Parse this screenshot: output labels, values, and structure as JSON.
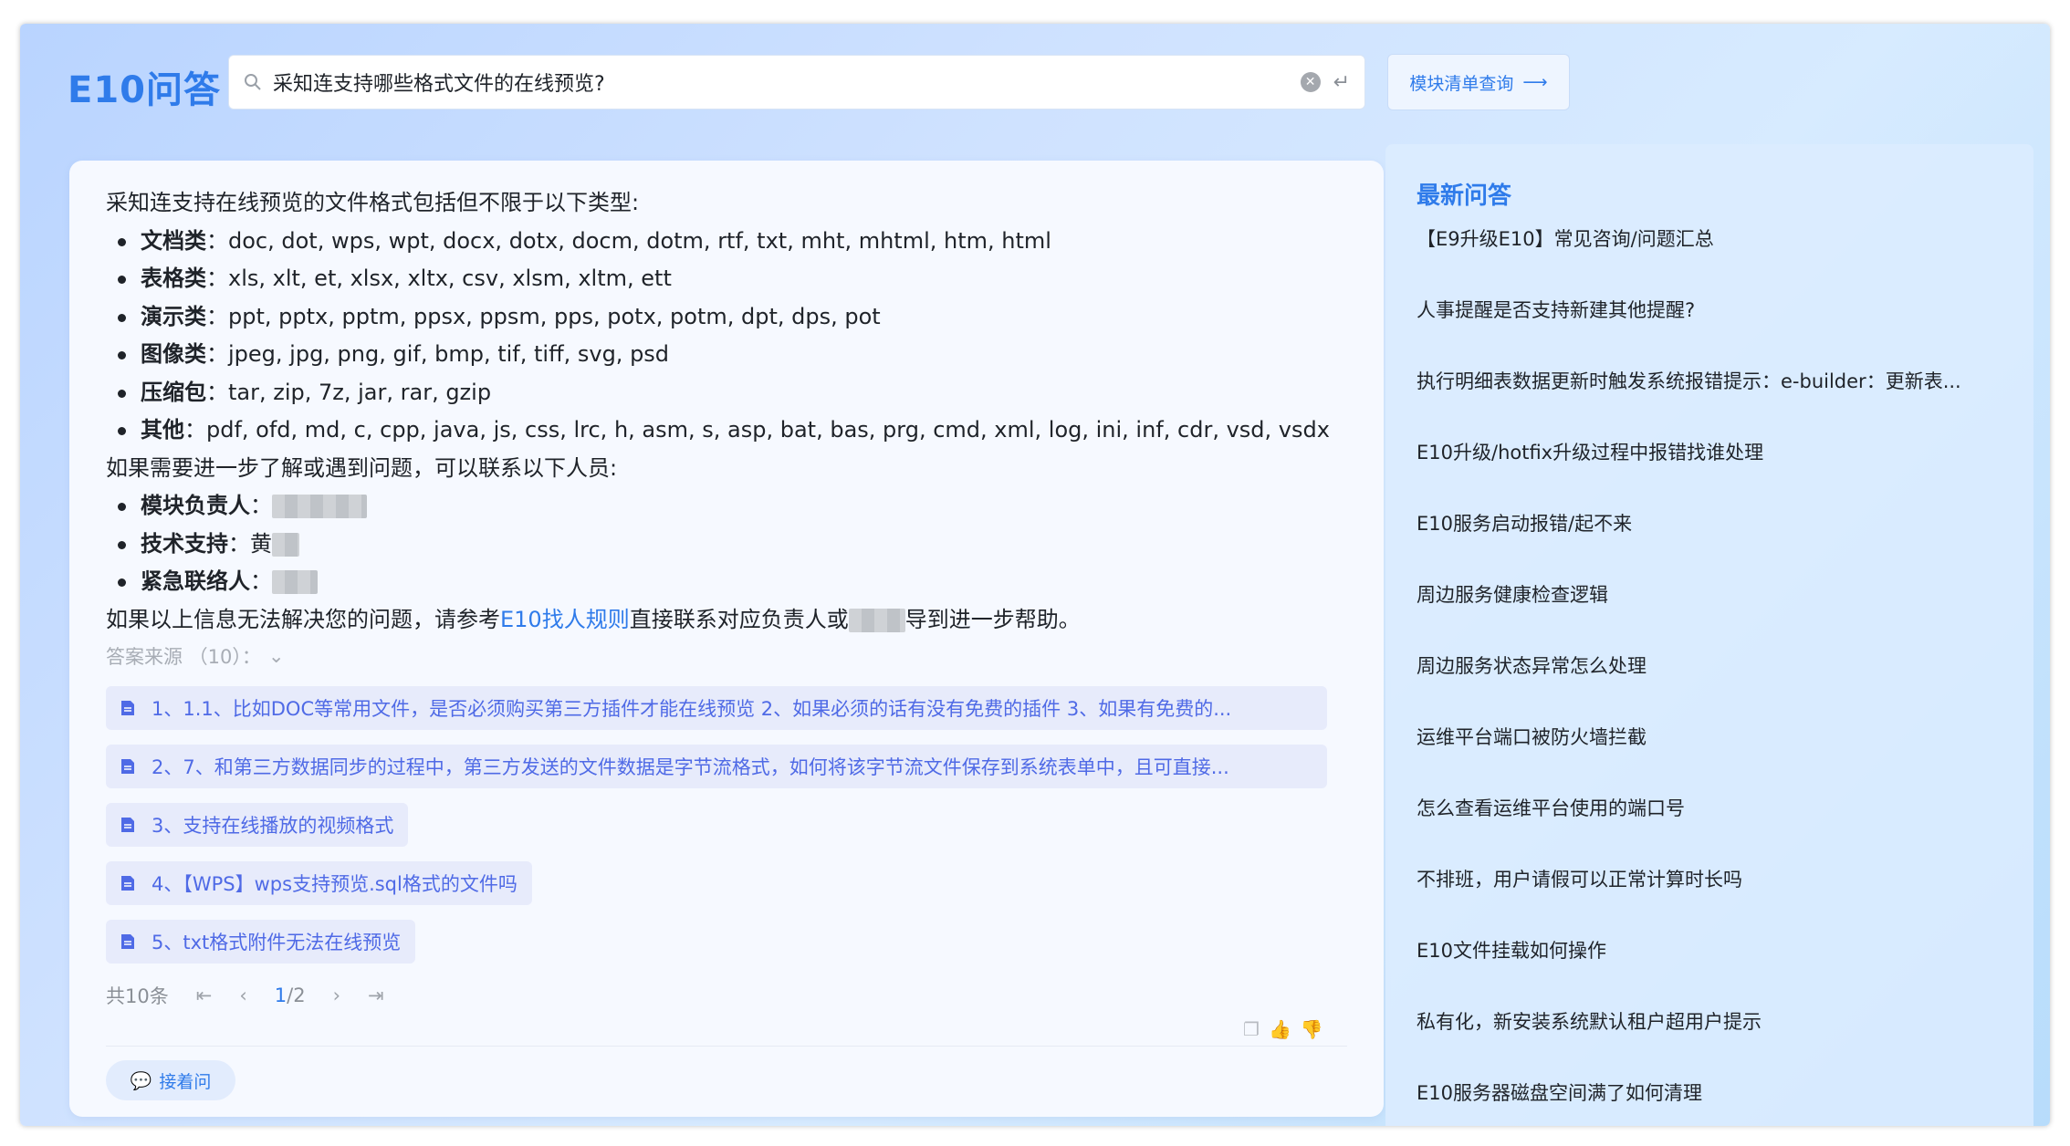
{
  "header": {
    "logo": "E10问答",
    "search_value": "采知连支持哪些格式文件的在线预览?",
    "module_button": "模块清单查询"
  },
  "answer": {
    "intro": "采知连支持在线预览的文件格式包括但不限于以下类型:",
    "formats": [
      {
        "label": "文档类",
        "value": "doc, dot, wps, wpt, docx, dotx, docm, dotm, rtf, txt, mht, mhtml, htm, html"
      },
      {
        "label": "表格类",
        "value": "xls, xlt, et, xlsx, xltx, csv, xlsm, xltm, ett"
      },
      {
        "label": "演示类",
        "value": "ppt, pptx, pptm, ppsx, ppsm, pps, potx, potm, dpt, dps, pot"
      },
      {
        "label": "图像类",
        "value": "jpeg, jpg, png, gif, bmp, tif, tiff, svg, psd"
      },
      {
        "label": "压缩包",
        "value": "tar, zip, 7z, jar, rar, gzip"
      },
      {
        "label": "其他",
        "value": "pdf, ofd, md, c, cpp, java, js, css, lrc, h, asm, s, asp, bat, bas, prg, cmd, xml, log, ini, inf, cdr, vsd, vsdx"
      }
    ],
    "contact_intro": "如果需要进一步了解或遇到问题，可以联系以下人员:",
    "contacts": [
      {
        "label": "模块负责人",
        "value": ""
      },
      {
        "label": "技术支持",
        "value": "黄"
      },
      {
        "label": "紧急联络人",
        "value": ""
      }
    ],
    "closing_pre": "如果以上信息无法解决您的问题，请参考",
    "closing_link": "E10找人规则",
    "closing_mid": "直接联系对应负责人或",
    "closing_post": "导到进一步帮助。"
  },
  "sources": {
    "header": "答案来源 （10）：",
    "items": [
      "1、1.1、比如DOC等常用文件，是否必须购买第三方插件才能在线预览 2、如果必须的话有没有免费的插件 3、如果有免费的...",
      "2、7、和第三方数据同步的过程中，第三方发送的文件数据是字节流格式，如何将该字节流文件保存到系统表单中，且可直接...",
      "3、支持在线播放的视频格式",
      "4、【WPS】wps支持预览.sql格式的文件吗",
      "5、txt格式附件无法在线预览"
    ]
  },
  "pagination": {
    "total": "共10条",
    "current": "1",
    "total_pages": "/2"
  },
  "follow_up": "接着问",
  "latest": {
    "title": "最新问答",
    "items": [
      "【E9升级E10】常见咨询/问题汇总",
      "人事提醒是否支持新建其他提醒?",
      "执行明细表数据更新时触发系统报错提示：e-builder：更新表...",
      "E10升级/hotfix升级过程中报错找谁处理",
      "E10服务启动报错/起不来",
      "周边服务健康检查逻辑",
      "周边服务状态异常怎么处理",
      "运维平台端口被防火墙拦截",
      "怎么查看运维平台使用的端口号",
      "不排班，用户请假可以正常计算时长吗",
      "E10文件挂载如何操作",
      "私有化，新安装系统默认租户超用户提示",
      "E10服务器磁盘空间满了如何清理"
    ]
  },
  "colors": {
    "accent": "#2f7bea",
    "source_bg": "#e7ebfb",
    "source_text": "#4f6ae6"
  }
}
